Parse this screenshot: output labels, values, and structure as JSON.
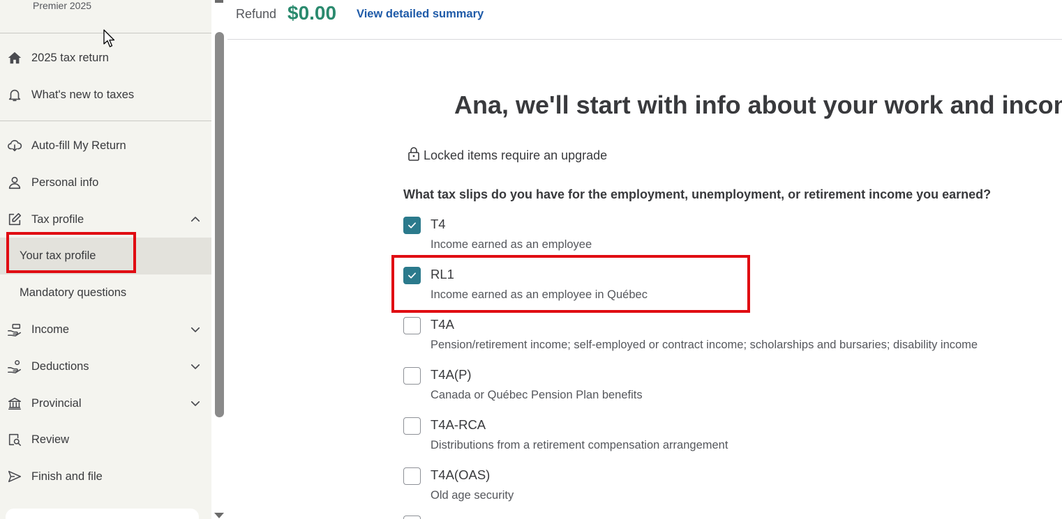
{
  "sidebar": {
    "product_name": "Premier 2025",
    "top_items": [
      {
        "label": "2025 tax return",
        "icon": "home-icon"
      },
      {
        "label": "What's new to taxes",
        "icon": "bell-icon"
      }
    ],
    "items": [
      {
        "label": "Auto-fill My Return",
        "icon": "cloud-download-icon"
      },
      {
        "label": "Personal info",
        "icon": "person-icon"
      },
      {
        "label": "Tax profile",
        "icon": "edit-icon",
        "expanded": true
      },
      {
        "label": "Income",
        "icon": "hand-coins-icon"
      },
      {
        "label": "Deductions",
        "icon": "hand-receive-icon"
      },
      {
        "label": "Provincial",
        "icon": "government-building-icon"
      },
      {
        "label": "Review",
        "icon": "document-search-icon"
      },
      {
        "label": "Finish and file",
        "icon": "send-icon"
      }
    ],
    "sub_items": [
      {
        "label": "Your tax profile",
        "active": true
      },
      {
        "label": "Mandatory questions",
        "active": false
      }
    ]
  },
  "header": {
    "refund_label": "Refund",
    "refund_amount": "$0.00",
    "detail_link": "View detailed summary"
  },
  "main": {
    "title": "Ana, we'll start with info about your work and income",
    "locked_note": "Locked items require an upgrade",
    "question": "What tax slips do you have for the employment, unemployment, or retirement income you earned?",
    "slips": [
      {
        "name": "T4",
        "desc": "Income earned as an employee",
        "checked": true
      },
      {
        "name": "RL1",
        "desc": "Income earned as an employee in Québec",
        "checked": true
      },
      {
        "name": "T4A",
        "desc": "Pension/retirement income; self-employed or contract income; scholarships and bursaries; disability income",
        "checked": false
      },
      {
        "name": "T4A(P)",
        "desc": "Canada or Québec Pension Plan benefits",
        "checked": false
      },
      {
        "name": "T4A-RCA",
        "desc": "Distributions from a retirement compensation arrangement",
        "checked": false
      },
      {
        "name": "T4A(OAS)",
        "desc": "Old age security",
        "checked": false
      }
    ]
  },
  "colors": {
    "accent_teal": "#2b7a8c",
    "refund_green": "#2a8a6e",
    "link_blue": "#1e5aa8",
    "highlight_red": "#e00b12",
    "sidebar_bg": "#f4f4ef"
  }
}
